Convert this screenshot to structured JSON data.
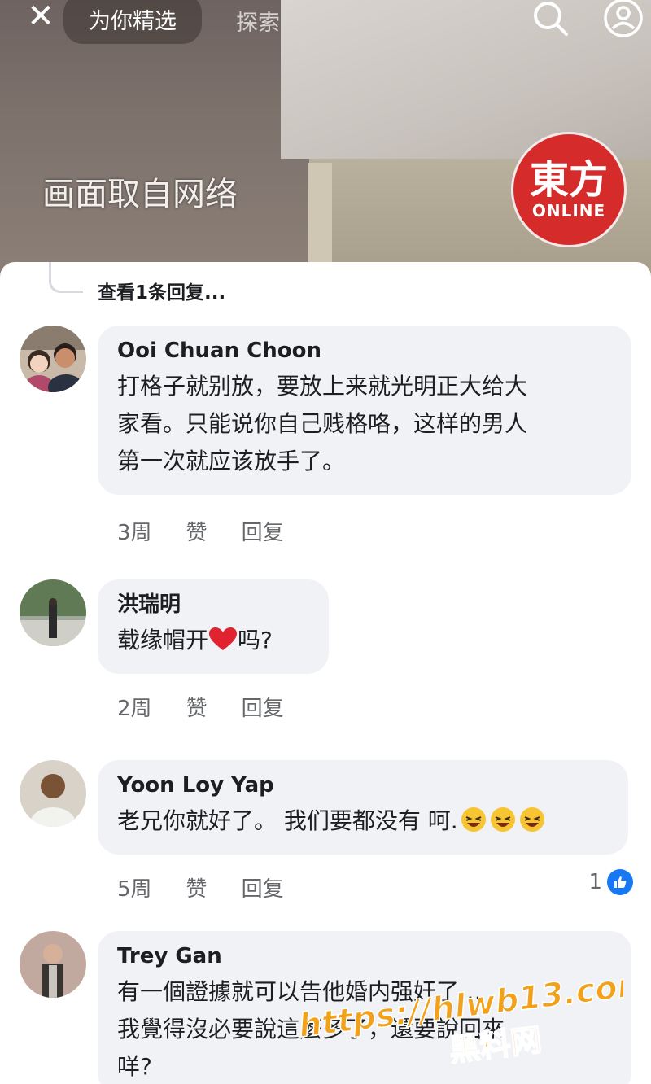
{
  "topbar": {
    "tab_active": "为你精选",
    "tab_explore": "探索",
    "close_icon": "close-icon",
    "search_icon": "search-icon",
    "profile_icon": "profile-icon"
  },
  "video": {
    "caption": "画面取自网络",
    "logo_main": "東方",
    "logo_sub": "ONLINE"
  },
  "thread": {
    "view_replies": "查看1条回复..."
  },
  "comments": [
    {
      "author": "Ooi Chuan Choon",
      "text_lines": [
        "打格子就别放，要放上来就光明正大给大",
        "家看。只能说你自己贱格咯，这样的男人",
        "第一次就应该放手了。"
      ],
      "time": "3周",
      "like": "赞",
      "reply": "回复"
    },
    {
      "author": "洪瑞明",
      "text_before": "载缘帽开",
      "text_after": "吗?",
      "time": "2周",
      "like": "赞",
      "reply": "回复"
    },
    {
      "author": "Yoon Loy Yap",
      "text": "老兄你就好了。 我们要都没有 呵.",
      "time": "5周",
      "like": "赞",
      "reply": "回复",
      "reaction_count": "1"
    },
    {
      "author": "Trey Gan",
      "text_lines": [
        "有一個證據就可以告他婚内强奸了…",
        "我覺得沒必要說這麼多了，還要說回來",
        "咩?"
      ]
    }
  ],
  "overlay": {
    "url": "https://hlwb13.com",
    "name": "黑料网"
  },
  "colors": {
    "bubble_bg": "#f0f2f5",
    "meta_text": "#65676b",
    "like_blue": "#1877f2",
    "logo_red": "#d52b2b",
    "watermark_orange": "#f2a21a"
  }
}
